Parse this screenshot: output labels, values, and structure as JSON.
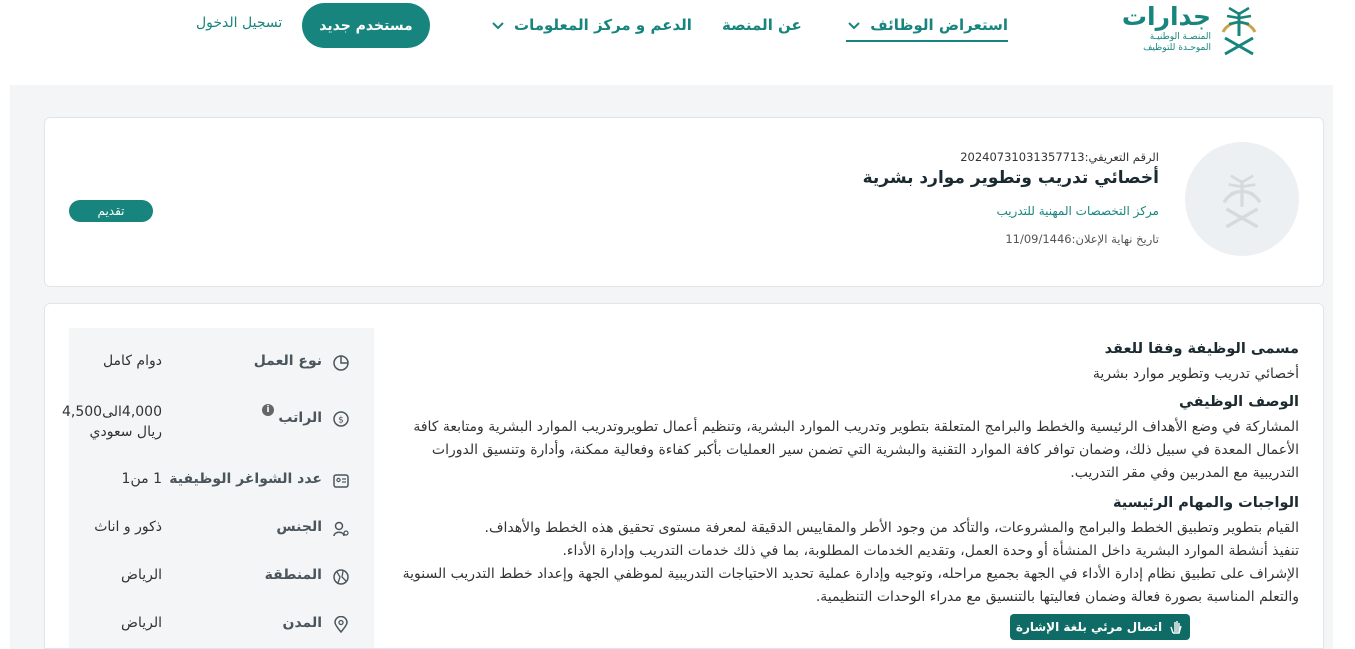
{
  "header": {
    "logo": {
      "brand": "جدارات",
      "line1": "المنصـة الوطنيـة",
      "line2": "الموحـدة للتوظيف"
    },
    "nav": {
      "jobs": "استعراض الوظائف",
      "about": "عن المنصة",
      "support": "الدعم و مركز المعلومات"
    },
    "new_user": "مستخدم جديد",
    "login": "تسجيل الدخول"
  },
  "job": {
    "id_label": "الرقم التعريفي:",
    "id_value": "20240731031357713",
    "title": "أخصائي تدريب وتطوير موارد بشرية",
    "company": "مركز التخصصات المهنية للتدريب",
    "deadline_label": "تاريخ نهاية الإعلان:",
    "deadline_value": "11/09/1446",
    "apply": "تقديم"
  },
  "attributes": [
    {
      "icon": "pie-chart-icon",
      "label": "نوع العمل",
      "value": "دوام كامل"
    },
    {
      "icon": "money-icon",
      "label": "الراتب",
      "value": "4,000الى4,500 ريال سعودي"
    },
    {
      "icon": "id-card-icon",
      "label": "عدد الشواغر الوظيفية",
      "value": "1 من1"
    },
    {
      "icon": "gender-icon",
      "label": "الجنس",
      "value": "ذكور و اناث"
    },
    {
      "icon": "map-icon",
      "label": "المنطقة",
      "value": "الرياض"
    },
    {
      "icon": "location-pin-icon",
      "label": "المدن",
      "value": "الرياض"
    }
  ],
  "details": {
    "contract_title_heading": "مسمى الوظيفة وفقا للعقد",
    "contract_title": "أخصائي تدريب وتطوير موارد بشرية",
    "description_heading": "الوصف الوظيفي",
    "description": "المشاركة في وضع الأهداف الرئيسية والخطط والبرامج المتعلقة بتطوير وتدريب الموارد البشرية، وتنظيم أعمال تطويروتدريب الموارد البشرية ومتابعة كافة الأعمال المعدة في سبيل ذلك، وضمان توافر كافة الموارد التقنية والبشرية التي تضمن سير العمليات بأكبر كفاءة وفعالية ممكنة، وأدارة وتنسيق الدورات التدريبية مع المدربين وفي مقر التدريب.",
    "duties_heading": "الواجبات والمهام الرئيسية",
    "duties": [
      "القيام بتطوير وتطبيق الخطط والبرامج والمشروعات، والتأكد من وجود الأطر والمقاييس الدقيقة لمعرفة مستوى تحقيق هذه الخطط والأهداف.",
      "تنفيذ أنشطة الموارد البشرية داخل المنشأة أو وحدة العمل، وتقديم الخدمات المطلوبة، بما في ذلك خدمات التدريب وإدارة الأداء.",
      "الإشراف على تطبيق نظام إدارة الأداء في الجهة بجميع مراحله، وتوجيه وإدارة عملية تحديد الاحتياجات التدريبية لموظفي الجهة وإعداد خطط التدريب السنوية والتعلم المناسبة بصورة فعالة وضمان فعاليتها بالتنسيق مع مدراء الوحدات التنظيمية."
    ]
  },
  "accessibility": {
    "sign_language": "اتصال مرئي بلغة الإشارة"
  },
  "colors": {
    "primary": "#17857e",
    "background": "#f4f5f6"
  }
}
